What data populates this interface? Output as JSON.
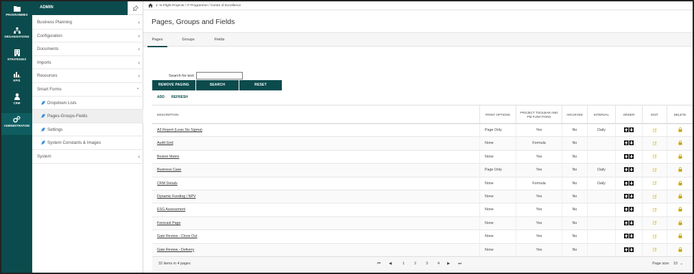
{
  "rail": {
    "items": [
      {
        "label": "PROGRAMMES",
        "icon": "folder-icon"
      },
      {
        "label": "ORGANISATIONS",
        "icon": "org-chart-icon"
      },
      {
        "label": "STRATEGIES",
        "icon": "building-icon"
      },
      {
        "label": "KPIS",
        "icon": "bar-chart-icon"
      },
      {
        "label": "CRM",
        "icon": "person-icon"
      },
      {
        "label": "ADMINISTRATION",
        "icon": "gears-icon"
      }
    ],
    "active": "ADMINISTRATION"
  },
  "sidebar": {
    "title": "ADMIN",
    "items": [
      {
        "label": "Business Planning",
        "chevron": "‹"
      },
      {
        "label": "Configuration",
        "chevron": "‹"
      },
      {
        "label": "Documents",
        "chevron": "‹"
      },
      {
        "label": "Imports",
        "chevron": "‹"
      },
      {
        "label": "Resources",
        "chevron": "‹"
      },
      {
        "label": "Smart Forms",
        "chevron": "⌄"
      },
      {
        "label": "Dropdown Lists"
      },
      {
        "label": "Pages-Groups-Fields"
      },
      {
        "label": "Settings"
      },
      {
        "label": "System Constants & Images"
      },
      {
        "label": "System",
        "chevron": "‹"
      }
    ]
  },
  "breadcrumb": "2. In-Flight Projects / IT Programme / Centre of Excellence",
  "page_title": "Pages, Groups and Fields",
  "tabs": [
    "Pages",
    "Groups",
    "Fields"
  ],
  "search": {
    "label": "Search for text:",
    "value": ""
  },
  "buttons": {
    "remove_paging": "REMOVE PAGING",
    "search": "SEARCH",
    "reset": "RESET"
  },
  "actions": {
    "add": "ADD",
    "refresh": "REFRESH"
  },
  "table": {
    "columns": [
      "DESCRIPTION",
      "PRINT OPTIONS",
      "PROJECT TOOLBAR AND PM FUNCTIONS",
      "ARCHIVED",
      "INTERVAL",
      "ORDER",
      "EDIT",
      "DELETE"
    ],
    "rows": [
      {
        "description": "A3 Report (Lean Six Sigma)",
        "print": "Page Only",
        "toolbar": "Yes",
        "archived": "No",
        "interval": "Daily"
      },
      {
        "description": "Audit Grid",
        "print": "None",
        "toolbar": "Formula",
        "archived": "No",
        "interval": ""
      },
      {
        "description": "Boston Matrix",
        "print": "None",
        "toolbar": "Yes",
        "archived": "No",
        "interval": ""
      },
      {
        "description": "Business Case",
        "print": "Page Only",
        "toolbar": "Yes",
        "archived": "No",
        "interval": "Daily"
      },
      {
        "description": "CRM Details",
        "print": "None",
        "toolbar": "Formula",
        "archived": "No",
        "interval": "Daily"
      },
      {
        "description": "Dynamic Funding / NPV",
        "print": "None",
        "toolbar": "Yes",
        "archived": "No",
        "interval": ""
      },
      {
        "description": "ESG Assessment",
        "print": "None",
        "toolbar": "Yes",
        "archived": "No",
        "interval": ""
      },
      {
        "description": "Forecast Page",
        "print": "None",
        "toolbar": "Yes",
        "archived": "No",
        "interval": ""
      },
      {
        "description": "Gate Review - Close Out",
        "print": "None",
        "toolbar": "Yes",
        "archived": "No",
        "interval": ""
      },
      {
        "description": "Gate Review - Delivery",
        "print": "None",
        "toolbar": "Yes",
        "archived": "No",
        "interval": ""
      }
    ]
  },
  "footer": {
    "count": "32 items in 4 pages",
    "pager": [
      "⏮",
      "◀",
      "1",
      "2",
      "3",
      "4",
      "▶",
      "⏭"
    ],
    "page_size_label": "Page size:",
    "page_size_value": "10"
  },
  "colors": {
    "brand": "#0c4b4d",
    "edit_icon": "#d9c24a",
    "lock_icon": "#c9a400"
  }
}
